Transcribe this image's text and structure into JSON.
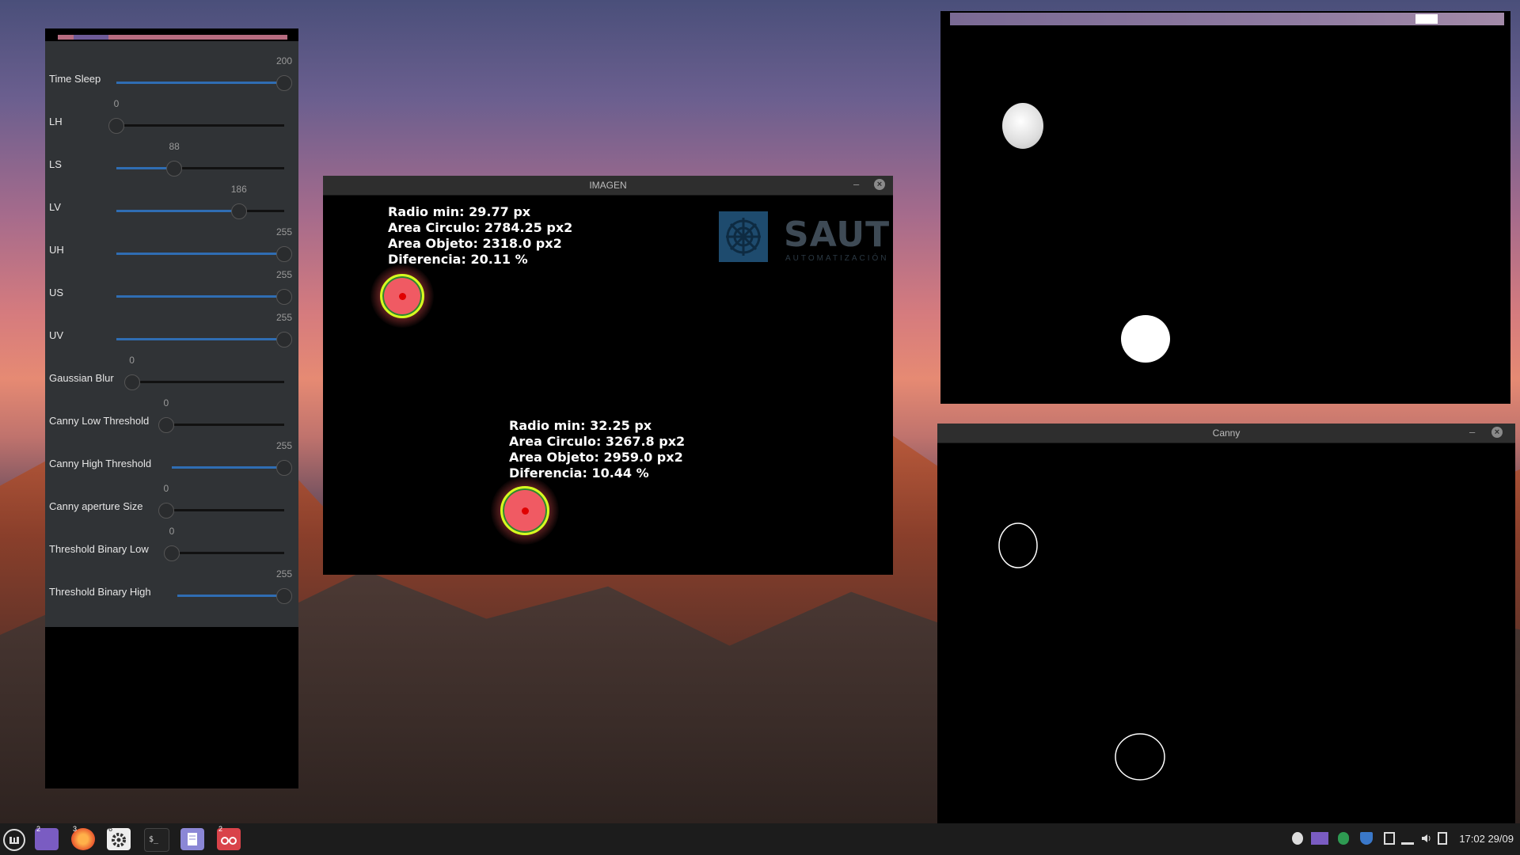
{
  "trackbars": [
    {
      "label": "Time Sleep",
      "value": "200",
      "fraction": 1.0
    },
    {
      "label": "LH",
      "value": "0",
      "fraction": 0.0
    },
    {
      "label": "LS",
      "value": "88",
      "fraction": 0.345
    },
    {
      "label": "LV",
      "value": "186",
      "fraction": 0.73
    },
    {
      "label": "UH",
      "value": "255",
      "fraction": 1.0
    },
    {
      "label": "US",
      "value": "255",
      "fraction": 1.0
    },
    {
      "label": "UV",
      "value": "255",
      "fraction": 1.0
    },
    {
      "label": "Gaussian Blur",
      "value": "0",
      "fraction": 0.0
    },
    {
      "label": "Canny Low Threshold",
      "value": "0",
      "fraction": 0.0
    },
    {
      "label": "Canny High Threshold",
      "value": "255",
      "fraction": 1.0
    },
    {
      "label": "Canny aperture Size",
      "value": "0",
      "fraction": 0.0
    },
    {
      "label": "Threshold Binary Low",
      "value": "0",
      "fraction": 0.0
    },
    {
      "label": "Threshold Binary High",
      "value": "255",
      "fraction": 1.0
    }
  ],
  "imagen": {
    "title": "IMAGEN",
    "minimize": "–",
    "close": "×",
    "obj1": {
      "line1": "Radio min: 29.77 px",
      "line2": "Area Circulo: 2784.25 px2",
      "line3": "Area Objeto: 2318.0 px2",
      "line4": "Diferencia: 20.11 %"
    },
    "obj2": {
      "line1": "Radio min: 32.25 px",
      "line2": "Area Circulo: 3267.8 px2",
      "line3": "Area Objeto: 2959.0 px2",
      "line4": "Diferencia: 10.44 %"
    },
    "logo_text": "SAUT",
    "logo_sub": "AUTOMATIZACIÓN"
  },
  "canny": {
    "title": "Canny",
    "minimize": "–",
    "close": "×"
  },
  "taskbar": {
    "badge_files": "2",
    "badge_firefox": "3",
    "badge_settings": "6",
    "badge_viewer": "2",
    "clock": "17:02 29/09"
  },
  "colors": {
    "accent": "#2f6db3",
    "ball": "#f05a63",
    "ring": "#d6ff1f"
  }
}
